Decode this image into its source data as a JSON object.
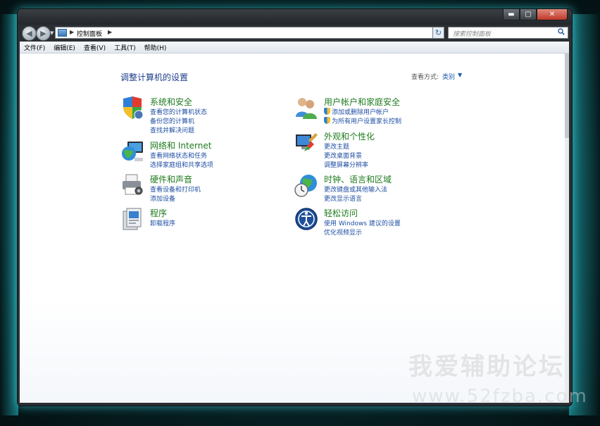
{
  "window": {
    "caption": {
      "minimize": "▬",
      "maximize": "▢",
      "close": "✕"
    }
  },
  "navbar": {
    "back": "◀",
    "forward": "▶",
    "history": "▼",
    "address": {
      "arrow1": "▶",
      "text": "控制面板",
      "arrow2": "▶",
      "dropdown": "▼"
    },
    "refresh": "↻",
    "search": {
      "placeholder": "搜索控制面板",
      "icon": "search-icon"
    }
  },
  "menubar": {
    "items": [
      "文件(F)",
      "编辑(E)",
      "查看(V)",
      "工具(T)",
      "帮助(H)"
    ]
  },
  "main": {
    "title": "调整计算机的设置",
    "viewby": {
      "label": "查看方式:",
      "value": "类别",
      "arrow": "▼"
    },
    "categories": [
      {
        "title": "系统和安全",
        "links": [
          "查看您的计算机状态",
          "备份您的计算机",
          "查找并解决问题"
        ]
      },
      {
        "title": "网络和 Internet",
        "links": [
          "查看网络状态和任务",
          "选择家庭组和共享选项"
        ]
      },
      {
        "title": "硬件和声音",
        "links": [
          "查看设备和打印机",
          "添加设备"
        ]
      },
      {
        "title": "程序",
        "links": [
          "卸载程序"
        ]
      },
      {
        "title": "用户帐户和家庭安全",
        "links": [
          "添加或删除用户帐户",
          "为所有用户设置家长控制"
        ]
      },
      {
        "title": "外观和个性化",
        "links": [
          "更改主题",
          "更改桌面背景",
          "调整屏幕分辨率"
        ]
      },
      {
        "title": "时钟、语言和区域",
        "links": [
          "更改键盘或其他输入法",
          "更改显示语言"
        ]
      },
      {
        "title": "轻松访问",
        "links": [
          "使用 Windows 建议的设置",
          "优化视频显示"
        ]
      }
    ]
  },
  "watermark": {
    "line1": "我爱辅助论坛",
    "line2": "www.52fzba.com"
  }
}
